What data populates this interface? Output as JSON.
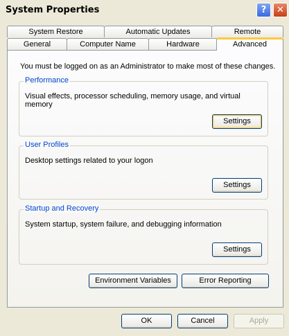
{
  "window": {
    "title": "System Properties",
    "help_glyph": "?",
    "close_glyph": "✕"
  },
  "tabs": {
    "row_back": [
      "System Restore",
      "Automatic Updates",
      "Remote"
    ],
    "row_front": [
      "General",
      "Computer Name",
      "Hardware",
      "Advanced"
    ],
    "active": "Advanced"
  },
  "advanced": {
    "admin_message": "You must be logged on as an Administrator to make most of these changes.",
    "performance": {
      "label": "Performance",
      "description": "Visual effects, processor scheduling, memory usage, and virtual memory",
      "button": "Settings"
    },
    "user_profiles": {
      "label": "User Profiles",
      "description": "Desktop settings related to your logon",
      "button": "Settings"
    },
    "startup_recovery": {
      "label": "Startup and Recovery",
      "description": "System startup, system failure, and debugging information",
      "button": "Settings"
    },
    "env_vars_button": "Environment Variables",
    "error_reporting_button": "Error Reporting"
  },
  "footer": {
    "ok": "OK",
    "cancel": "Cancel",
    "apply": "Apply"
  }
}
